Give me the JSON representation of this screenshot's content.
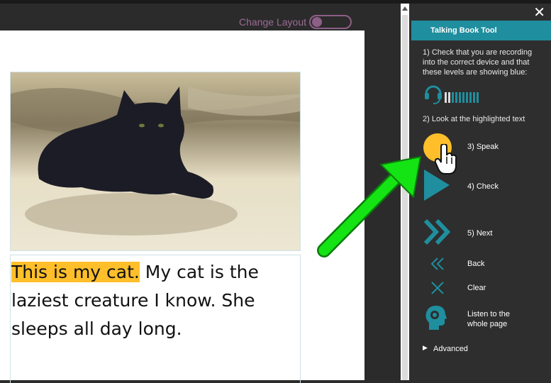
{
  "layout_toggle": {
    "label": "Change Layout",
    "on": false
  },
  "book": {
    "highlighted": "This is my cat.",
    "rest_line1": " My cat is the",
    "line2": "laziest creature I know. She",
    "line3": "sleeps all day long."
  },
  "image": {
    "description": "black cat lying on ground"
  },
  "panel": {
    "title": "Talking Book Tool",
    "close": "✕",
    "instruction1": "1) Check that you are recording into the correct device and that these levels are showing blue:",
    "instruction2": "2) Look at the highlighted text",
    "speak": "3) Speak",
    "check": "4) Check",
    "next": "5) Next",
    "back": "Back",
    "clear": "Clear",
    "listen": "Listen to the whole page",
    "advanced": "Advanced",
    "advanced_icon": "▶"
  },
  "colors": {
    "accent": "#1f8e9e",
    "highlight": "#febf2a",
    "speak_button": "#febf2a",
    "icon_teal": "#1f8e9e",
    "arrow_green": "#14e314"
  }
}
